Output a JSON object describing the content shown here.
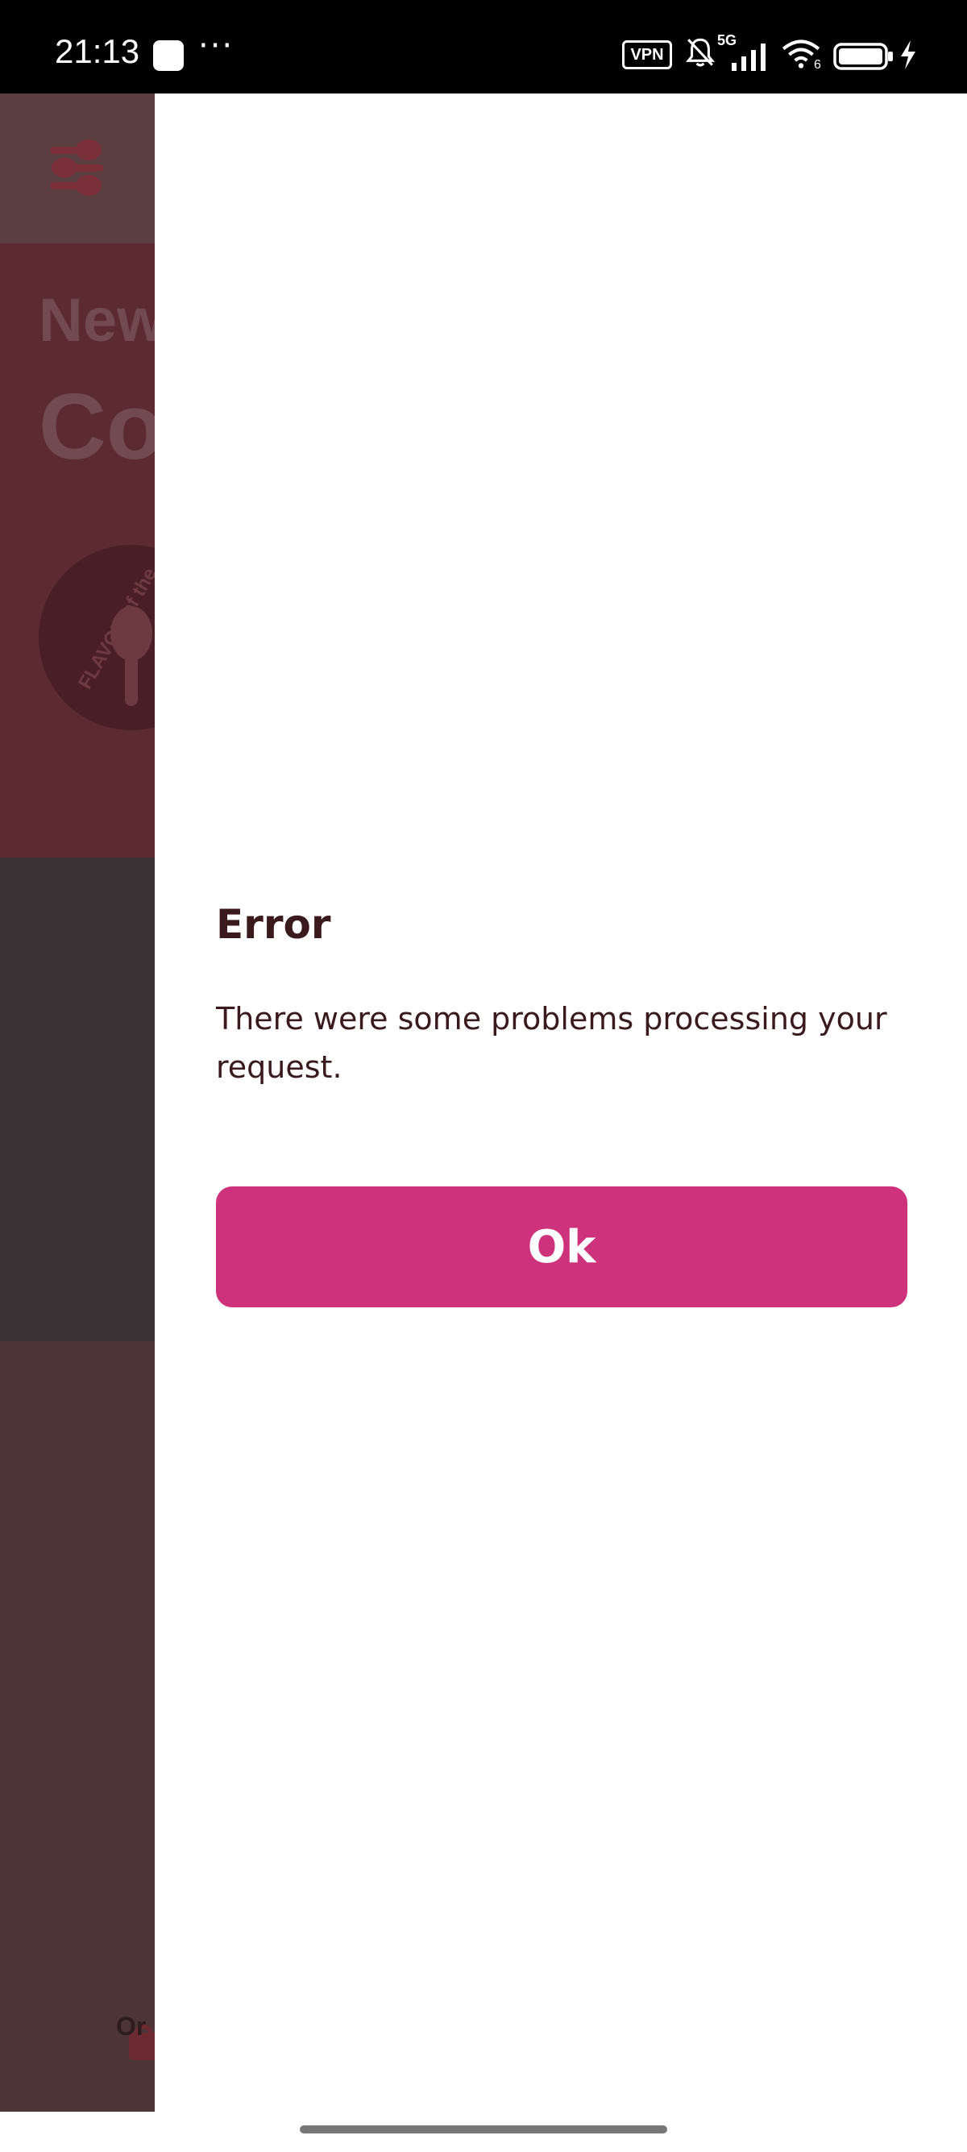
{
  "status_bar": {
    "time": "21:13",
    "overflow": "···",
    "vpn_label": "VPN",
    "network_label": "5G",
    "wifi_badge": "6",
    "icons": [
      "app-notification-icon",
      "vpn-icon",
      "bell-muted-icon",
      "signal-icon",
      "wifi-icon",
      "battery-icon",
      "charging-icon"
    ]
  },
  "background_app": {
    "hero_line1": "New",
    "hero_line2": "Co",
    "seal_text": "FLAVOR of the",
    "nav_label": "Or",
    "icons": [
      "spoons-menu-icon",
      "order-bag-icon",
      "spoon-icon"
    ]
  },
  "dialog": {
    "title": "Error",
    "message": "There were some problems processing your request.",
    "ok_label": "Ok"
  },
  "colors": {
    "accent": "#cf327d",
    "text_dark": "#3a1a1d",
    "overlay_bg": "#4d3437"
  }
}
